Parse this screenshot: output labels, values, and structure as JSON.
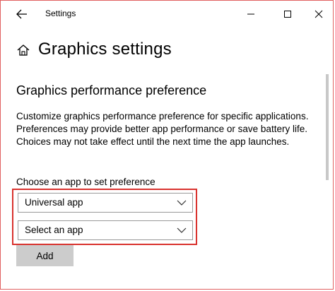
{
  "window": {
    "title": "Settings",
    "controls": {
      "minimize": "minimize-icon",
      "maximize": "maximize-icon",
      "close": "close-icon"
    },
    "back_icon": "back-arrow-icon"
  },
  "page": {
    "title": "Graphics settings",
    "home_icon": "home-icon"
  },
  "section": {
    "title": "Graphics performance preference",
    "description": "Customize graphics performance preference for specific applications. Preferences may provide better app performance or save battery life. Choices may not take effect until the next time the app launches.",
    "choose_label": "Choose an app to set preference",
    "app_type_dropdown": {
      "selected": "Universal app"
    },
    "app_dropdown": {
      "selected": "Select an app"
    },
    "add_button": "Add"
  },
  "colors": {
    "highlight": "#d9322e",
    "button_bg": "#cccccc",
    "dropdown_border": "#9a9a9a",
    "scrollbar": "#c8c8c8"
  }
}
